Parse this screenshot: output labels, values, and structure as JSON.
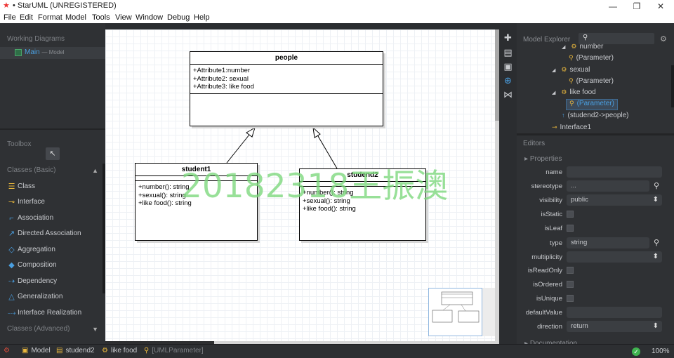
{
  "window": {
    "title": "• StarUML (UNREGISTERED)",
    "minimize": "—",
    "maximize": "❐",
    "close": "✕"
  },
  "menu": [
    "File",
    "Edit",
    "Format",
    "Model",
    "Tools",
    "View",
    "Window",
    "Debug",
    "Help"
  ],
  "working_diagrams": {
    "header": "Working Diagrams",
    "item_label": "Main",
    "item_sub": "— Model"
  },
  "toolbox": {
    "header": "Toolbox",
    "cursor": "↖",
    "basic_header": "Classes (Basic)",
    "items": [
      "Class",
      "Interface",
      "Association",
      "Directed Association",
      "Aggregation",
      "Composition",
      "Dependency",
      "Generalization",
      "Interface Realization"
    ],
    "advanced_header": "Classes (Advanced)"
  },
  "diagram": {
    "people": {
      "name": "people",
      "attrs": [
        "+Attribute1:number",
        "+Attribute2: sexual",
        "+Attribute3: like food"
      ]
    },
    "student1": {
      "name": "student1",
      "ops": [
        "+number(): string",
        "+sexual(): string",
        "+like food(): string"
      ]
    },
    "studend2": {
      "name": "studend2",
      "ops": [
        "+number(): string",
        "+sexual(): string",
        "+like food(): string"
      ]
    },
    "watermark": "20182318王振澳"
  },
  "explorer": {
    "title": "Model Explorer",
    "rows": [
      {
        "text": "number",
        "icon": "⚙"
      },
      {
        "text": "(Parameter)",
        "icon": "⚲"
      },
      {
        "text": "sexual",
        "icon": "⚙"
      },
      {
        "text": "(Parameter)",
        "icon": "⚲"
      },
      {
        "text": "like food",
        "icon": "⚙"
      },
      {
        "text": "(Parameter)",
        "icon": "⚲"
      },
      {
        "text": "(studend2->people)",
        "icon": "↑"
      },
      {
        "text": "Interface1",
        "icon": "⊸"
      }
    ]
  },
  "editors": {
    "title": "Editors",
    "properties_title": "Properties",
    "fields": {
      "name": {
        "label": "name",
        "value": ""
      },
      "stereotype": {
        "label": "stereotype",
        "value": "..."
      },
      "visibility": {
        "label": "visibility",
        "value": "public"
      },
      "isStatic": {
        "label": "isStatic"
      },
      "isLeaf": {
        "label": "isLeaf"
      },
      "type": {
        "label": "type",
        "value": "string"
      },
      "multiplicity": {
        "label": "multiplicity",
        "value": ""
      },
      "isReadOnly": {
        "label": "isReadOnly"
      },
      "isOrdered": {
        "label": "isOrdered"
      },
      "isUnique": {
        "label": "isUnique"
      },
      "defaultValue": {
        "label": "defaultValue",
        "value": ""
      },
      "direction": {
        "label": "direction",
        "value": "return"
      }
    },
    "documentation_title": "Documentation"
  },
  "statusbar": {
    "items": [
      {
        "text": "Model",
        "icon": "▣"
      },
      {
        "text": "studend2",
        "icon": "▤"
      },
      {
        "text": "like food",
        "icon": "⚙"
      },
      {
        "text": "[UMLParameter]",
        "icon": "⚲"
      }
    ],
    "zoom": "100%"
  },
  "colors": {
    "accent": "#4a9fe0",
    "icon_yellow": "#e9b73d",
    "watermark_green": "#7cd87c"
  }
}
